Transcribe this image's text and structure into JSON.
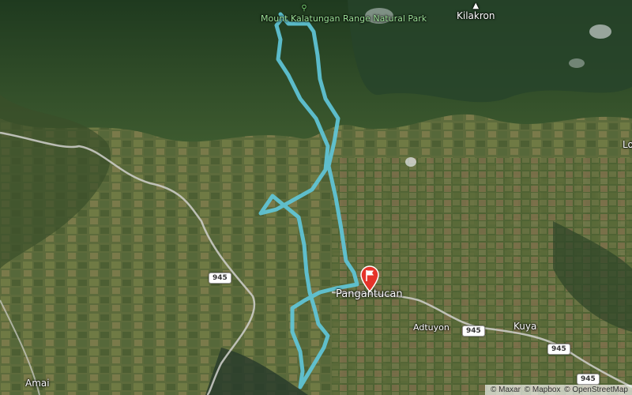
{
  "map": {
    "labels": {
      "park": "Mount Kalatungan Range Natural Park",
      "peak": "Kilakron",
      "town": "Pangantucan",
      "adtuyon": "Adtuyon",
      "kuya": "Kuya",
      "amai": "Amai",
      "edge_right": "Lo"
    },
    "road_shields": [
      "945",
      "945",
      "945",
      "945"
    ],
    "attribution": {
      "maxar": "© Maxar",
      "mapbox": "© Mapbox",
      "osm": "© OpenStreetMap"
    },
    "icons": {
      "park": "park-icon",
      "peak": "mountain-peak-icon",
      "marker": "flag-marker-icon"
    },
    "colors": {
      "route": "#5fc6d8",
      "marker": "#e5332a",
      "road": "#c8c8c8"
    }
  }
}
